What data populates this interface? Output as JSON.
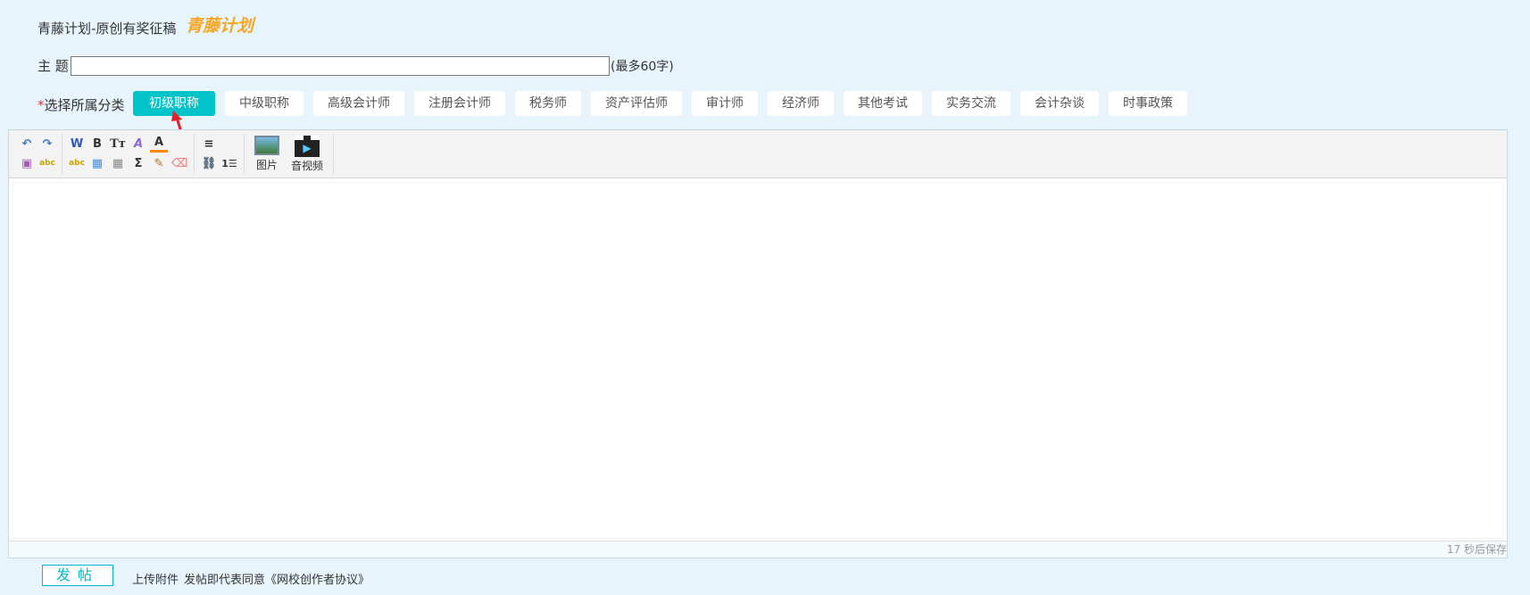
{
  "header": {
    "title": "青藤计划-原创有奖征稿",
    "logo_text": "青藤计划"
  },
  "subject": {
    "label": "主 题",
    "value": "",
    "hint": "(最多60字)"
  },
  "category": {
    "required_mark": "*",
    "label": "选择所属分类",
    "selected": "初级职称",
    "items": [
      "初级职称",
      "中级职称",
      "高级会计师",
      "注册会计师",
      "税务师",
      "资产评估师",
      "审计师",
      "经济师",
      "其他考试",
      "实务交流",
      "会计杂谈",
      "时事政策"
    ]
  },
  "toolbar": {
    "image_label": "图片",
    "video_label": "音视频"
  },
  "editor": {
    "content": "",
    "autosave_status": "17 秒后保存"
  },
  "footer": {
    "post_label": "发帖",
    "upload_label": "上传附件",
    "agreement_text": "发帖即代表同意《网校创作者协议》"
  },
  "colors": {
    "accent": "#00c4c8",
    "logo": "#f5a623",
    "background": "#e8f4fc"
  }
}
